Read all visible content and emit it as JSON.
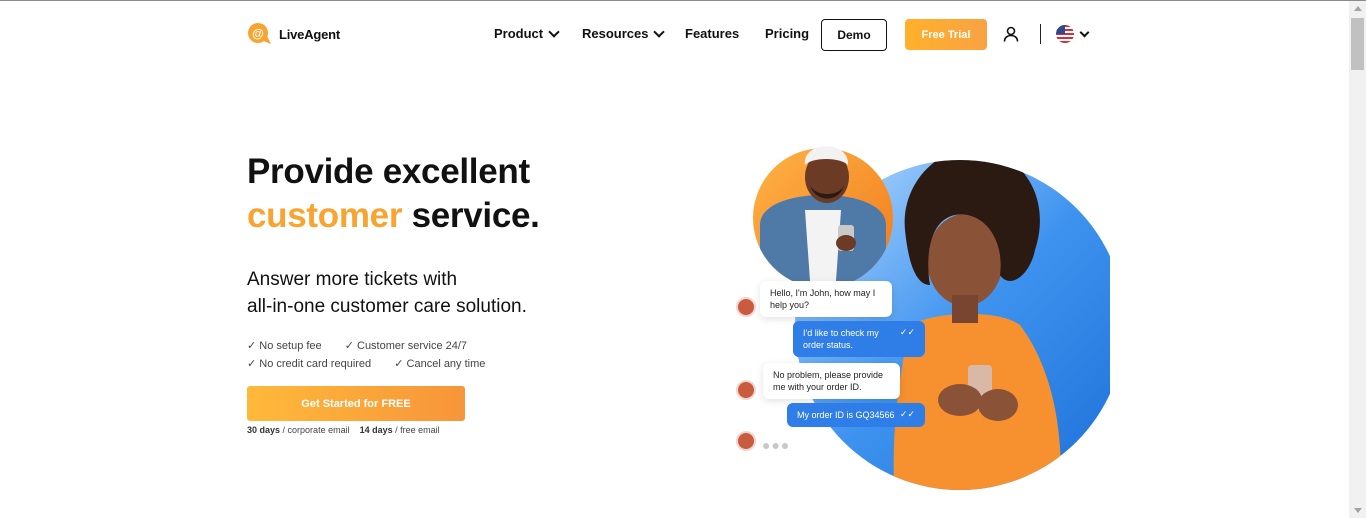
{
  "header": {
    "logo_text": "LiveAgent",
    "nav": [
      {
        "label": "Product",
        "has_dropdown": true
      },
      {
        "label": "Resources",
        "has_dropdown": true
      },
      {
        "label": "Features",
        "has_dropdown": false
      },
      {
        "label": "Pricing",
        "has_dropdown": false
      }
    ],
    "demo_label": "Demo",
    "trial_label": "Free Trial"
  },
  "hero": {
    "title_line1": "Provide excellent",
    "title_highlight": "customer",
    "title_rest": "service.",
    "subtitle_line1": "Answer more tickets with",
    "subtitle_line2": "all-in-one customer care solution.",
    "checks": [
      "No setup fee",
      "Customer service 24/7",
      "No credit card required",
      "Cancel any time"
    ],
    "cta_label": "Get Started for FREE",
    "note_days_1": "30 days",
    "note_text_1": "/ corporate email",
    "note_days_2": "14 days",
    "note_text_2": "/ free email"
  },
  "chat": {
    "messages": [
      {
        "from": "agent",
        "text": "Hello, I'm John, how may I help you?"
      },
      {
        "from": "user",
        "text": "I'd like to check my order status."
      },
      {
        "from": "agent",
        "text": "No problem, please provide me with your order ID."
      },
      {
        "from": "user",
        "text": "My order ID is GQ34566"
      }
    ]
  },
  "colors": {
    "accent_orange": "#f9a430",
    "chat_blue": "#2f7de6"
  }
}
